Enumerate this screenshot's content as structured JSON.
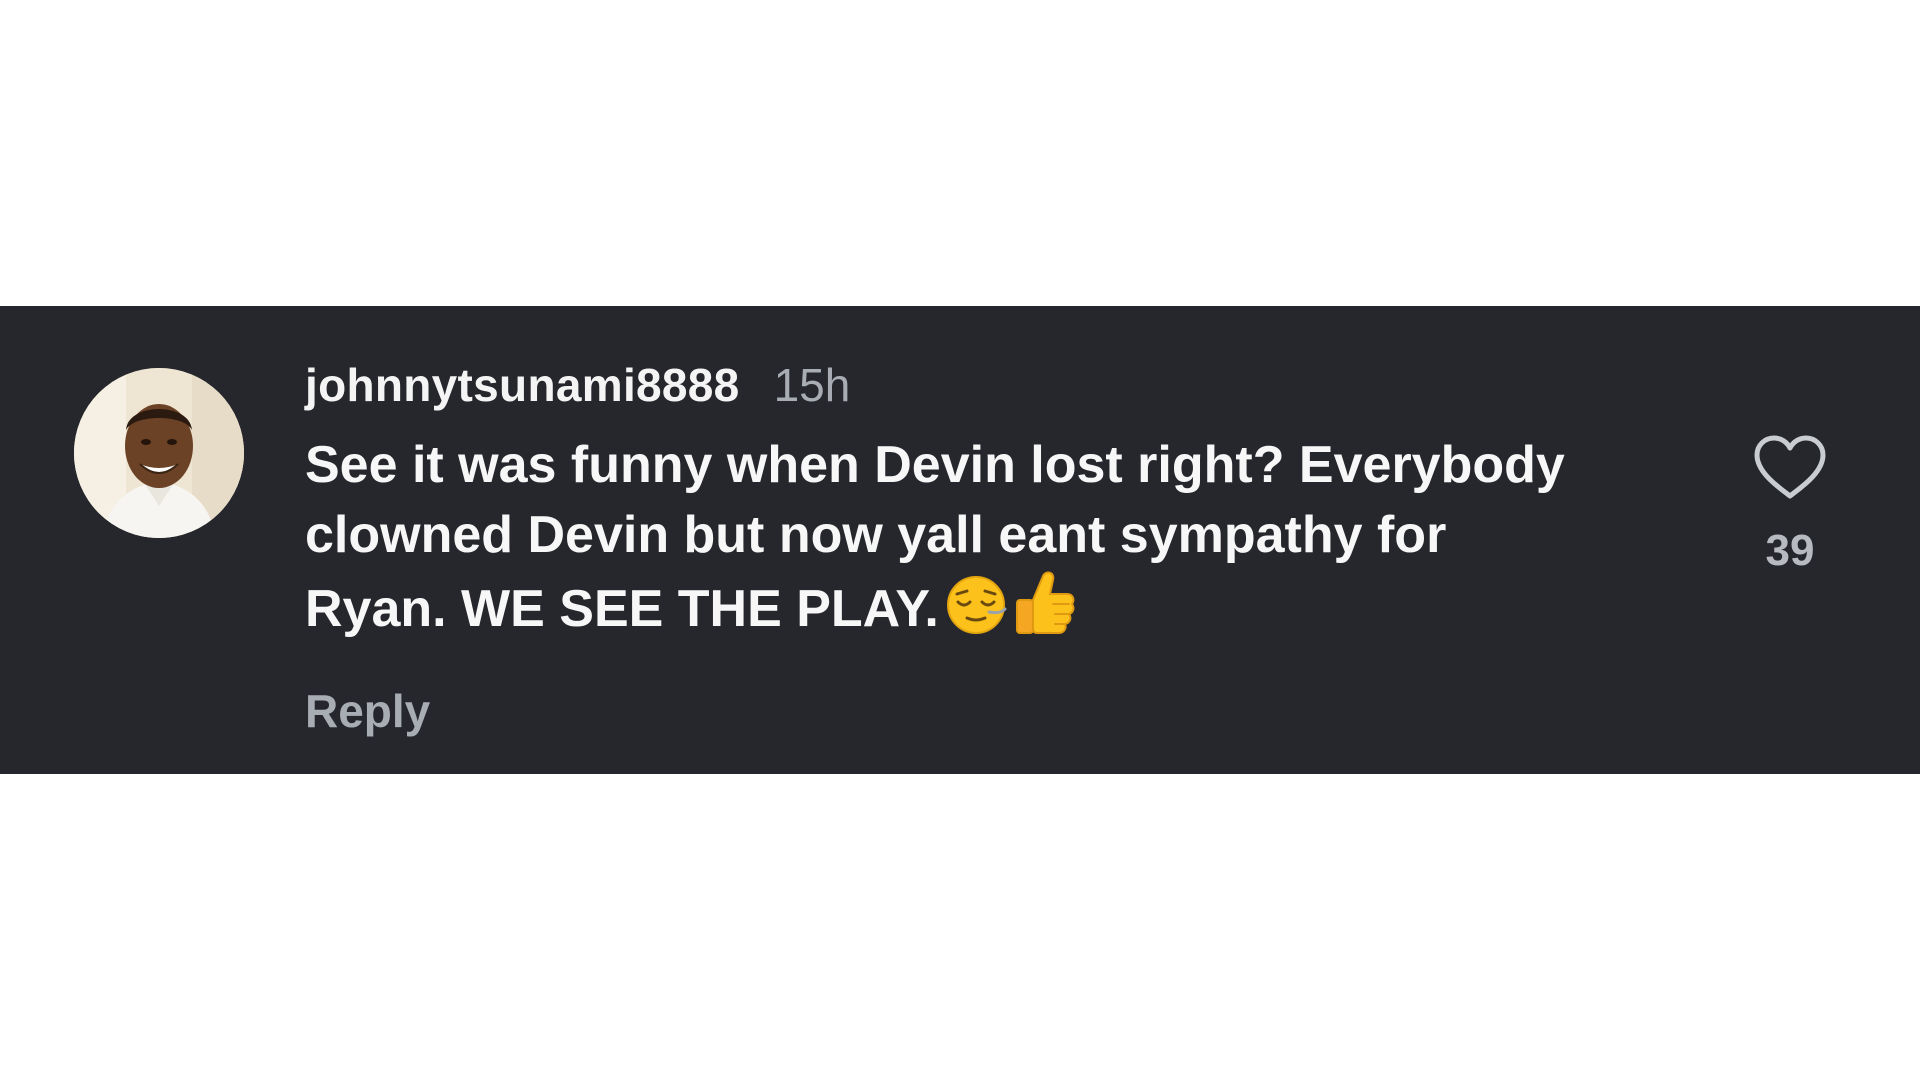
{
  "comment": {
    "username": "johnnytsunami8888",
    "timestamp": "15h",
    "text_lines": [
      "See it was funny when Devin lost right? Everybody",
      "clowned Devin but now yall eant sympathy for",
      "Ryan. WE SEE THE PLAY."
    ],
    "emojis": [
      "relieved-face-emoji",
      "thumbs-up-emoji"
    ],
    "reply_label": "Reply",
    "like_count": "39",
    "like_icon": "heart-outline-icon",
    "avatar": "profile-photo"
  },
  "colors": {
    "card_background": "#25272c",
    "primary_text": "#f4f4f4",
    "secondary_text": "#a8acb3",
    "page_background": "#ffffff"
  }
}
